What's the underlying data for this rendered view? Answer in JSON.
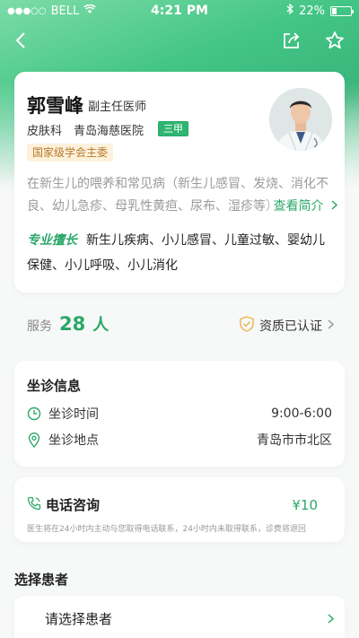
{
  "status_bar": {
    "signal": "●●●○○",
    "carrier": "BELL",
    "time": "4:21 PM",
    "battery": "22%"
  },
  "doctor": {
    "name": "郭雪峰",
    "title": "副主任医师",
    "department": "皮肤科",
    "hospital": "青岛海慈医院",
    "grade": "三甲",
    "honor": "国家级学会主委",
    "intro": "在新生儿的喂养和常见病（新生儿感冒、发烧、消化不良、幼儿急疹、母乳性黄疸、尿布、湿疹等）",
    "intro_more": "查看简介",
    "specialty_label": "专业擅长",
    "specialty": "新生儿疾病、小儿感冒、儿童过敏、婴幼儿保健、小儿呼吸、小儿消化"
  },
  "stats": {
    "served_label": "服务",
    "served_count": "28",
    "served_unit": "人",
    "certified": "资质已认证"
  },
  "schedule": {
    "title": "坐诊信息",
    "time_label": "坐诊时间",
    "time_value": "9:00-6:00",
    "place_label": "坐诊地点",
    "place_value": "青岛市市北区"
  },
  "phone_consult": {
    "title": "电话咨询",
    "price": "¥10",
    "note": "医生将在24小时内主动与您取得电话联系，24小时内未取得联系，诊费将退回"
  },
  "patient": {
    "section_title": "选择患者",
    "placeholder": "请选择患者"
  },
  "colors": {
    "accent": "#2aa868",
    "header_gradient": "#42c585"
  }
}
